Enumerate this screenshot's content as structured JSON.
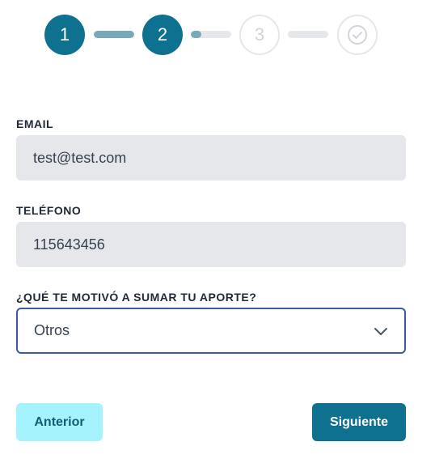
{
  "stepper": {
    "steps": [
      {
        "label": "1",
        "state": "active"
      },
      {
        "label": "2",
        "state": "active"
      },
      {
        "label": "3",
        "state": "inactive"
      },
      {
        "label": "",
        "state": "inactive",
        "icon": "check-circle-icon"
      }
    ],
    "connectors": [
      {
        "progress": 1.0
      },
      {
        "progress": 0.25
      },
      {
        "progress": 0.0
      }
    ],
    "colors": {
      "active": "#0f7190",
      "progress": "#79a9b8",
      "inactive": "#e5e7eb"
    }
  },
  "form": {
    "email": {
      "label": "EMAIL",
      "value": "test@test.com"
    },
    "phone": {
      "label": "TELÉFONO",
      "value": "115643456"
    },
    "motivation": {
      "label": "¿QUÉ TE MOTIVÓ A SUMAR TU APORTE?",
      "selected": "Otros",
      "icon": "chevron-down-icon"
    }
  },
  "actions": {
    "prev_label": "Anterior",
    "next_label": "Siguiente"
  }
}
